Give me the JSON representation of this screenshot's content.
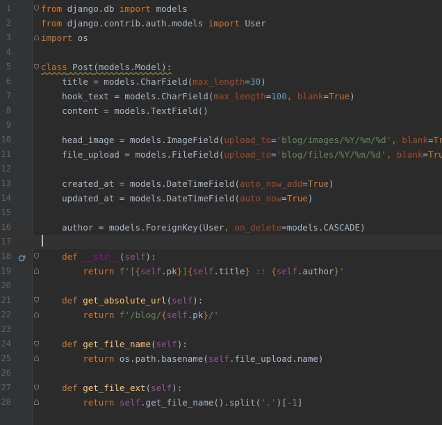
{
  "editor": {
    "current_line": 17,
    "lines": [
      {
        "n": "1",
        "fold": "open",
        "tokens": [
          {
            "t": "from",
            "c": "kw"
          },
          {
            "t": " django.db ",
            "c": ""
          },
          {
            "t": "import",
            "c": "kw"
          },
          {
            "t": " models",
            "c": ""
          }
        ]
      },
      {
        "n": "2",
        "fold": "none",
        "tokens": [
          {
            "t": "from",
            "c": "kw"
          },
          {
            "t": " django.contrib.auth.models ",
            "c": ""
          },
          {
            "t": "import",
            "c": "kw"
          },
          {
            "t": " User",
            "c": ""
          }
        ]
      },
      {
        "n": "3",
        "fold": "close",
        "tokens": [
          {
            "t": "import",
            "c": "kw"
          },
          {
            "t": " os",
            "c": ""
          }
        ]
      },
      {
        "n": "4",
        "fold": "none",
        "tokens": []
      },
      {
        "n": "5",
        "fold": "open",
        "tokens": [
          {
            "t": "class Post(models.Model):",
            "c": "kw wavy",
            "parts": [
              {
                "t": "class",
                "c": "kw"
              },
              {
                "t": " Post",
                "c": ""
              },
              {
                "t": "(models.Model):",
                "c": ""
              }
            ]
          }
        ]
      },
      {
        "n": "6",
        "fold": "none",
        "tokens": [
          {
            "t": "    title = models.",
            "c": ""
          },
          {
            "t": "CharField",
            "c": ""
          },
          {
            "t": "(",
            "c": ""
          },
          {
            "t": "max_length",
            "c": "param"
          },
          {
            "t": "=",
            "c": ""
          },
          {
            "t": "30",
            "c": "num"
          },
          {
            "t": ")",
            "c": ""
          }
        ]
      },
      {
        "n": "7",
        "fold": "none",
        "tokens": [
          {
            "t": "    hook_text = models.CharField(",
            "c": ""
          },
          {
            "t": "max_length",
            "c": "param"
          },
          {
            "t": "=",
            "c": ""
          },
          {
            "t": "100",
            "c": "num"
          },
          {
            "t": ", ",
            "c": "kw"
          },
          {
            "t": "blank",
            "c": "param"
          },
          {
            "t": "=",
            "c": ""
          },
          {
            "t": "True",
            "c": "kw"
          },
          {
            "t": ")",
            "c": ""
          }
        ]
      },
      {
        "n": "8",
        "fold": "none",
        "tokens": [
          {
            "t": "    content = models.TextField()",
            "c": ""
          }
        ]
      },
      {
        "n": "9",
        "fold": "none",
        "tokens": []
      },
      {
        "n": "10",
        "fold": "none",
        "tokens": [
          {
            "t": "    head_image = models.ImageField(",
            "c": ""
          },
          {
            "t": "upload_to",
            "c": "param"
          },
          {
            "t": "=",
            "c": ""
          },
          {
            "t": "'blog/images/%Y/%m/%d'",
            "c": "str"
          },
          {
            "t": ", ",
            "c": "kw"
          },
          {
            "t": "blank",
            "c": "param"
          },
          {
            "t": "=",
            "c": ""
          },
          {
            "t": "True",
            "c": "kw"
          },
          {
            "t": ")",
            "c": ""
          }
        ]
      },
      {
        "n": "11",
        "fold": "none",
        "tokens": [
          {
            "t": "    file_upload = models.FileField(",
            "c": ""
          },
          {
            "t": "upload_to",
            "c": "param"
          },
          {
            "t": "=",
            "c": ""
          },
          {
            "t": "'blog/files/%Y/%m/%d'",
            "c": "str"
          },
          {
            "t": ", ",
            "c": "kw"
          },
          {
            "t": "blank",
            "c": "param"
          },
          {
            "t": "=",
            "c": ""
          },
          {
            "t": "True",
            "c": "kw"
          },
          {
            "t": ")",
            "c": ""
          }
        ]
      },
      {
        "n": "12",
        "fold": "none",
        "tokens": []
      },
      {
        "n": "13",
        "fold": "none",
        "tokens": [
          {
            "t": "    created_at = models.DateTimeField(",
            "c": ""
          },
          {
            "t": "auto_now_add",
            "c": "param"
          },
          {
            "t": "=",
            "c": ""
          },
          {
            "t": "True",
            "c": "kw"
          },
          {
            "t": ")",
            "c": ""
          }
        ]
      },
      {
        "n": "14",
        "fold": "none",
        "tokens": [
          {
            "t": "    updated_at = models.DateTimeField(",
            "c": ""
          },
          {
            "t": "auto_now",
            "c": "param"
          },
          {
            "t": "=",
            "c": ""
          },
          {
            "t": "True",
            "c": "kw"
          },
          {
            "t": ")",
            "c": ""
          }
        ]
      },
      {
        "n": "15",
        "fold": "none",
        "tokens": []
      },
      {
        "n": "16",
        "fold": "none",
        "tokens": [
          {
            "t": "    author = models.ForeignKey(User",
            "c": ""
          },
          {
            "t": ", ",
            "c": "kw"
          },
          {
            "t": "on_delete",
            "c": "param"
          },
          {
            "t": "=models.CASCADE)",
            "c": ""
          }
        ]
      },
      {
        "n": "17",
        "fold": "none",
        "tokens": []
      },
      {
        "n": "18",
        "fold": "open",
        "icon": "override-method-icon",
        "tokens": [
          {
            "t": "    ",
            "c": ""
          },
          {
            "t": "def",
            "c": "kw"
          },
          {
            "t": " ",
            "c": ""
          },
          {
            "t": "__str__",
            "c": "magic"
          },
          {
            "t": "(",
            "c": ""
          },
          {
            "t": "self",
            "c": "self"
          },
          {
            "t": "):",
            "c": ""
          }
        ]
      },
      {
        "n": "19",
        "fold": "close",
        "tokens": [
          {
            "t": "        ",
            "c": ""
          },
          {
            "t": "return",
            "c": "kw"
          },
          {
            "t": " ",
            "c": ""
          },
          {
            "t": "f'[",
            "c": "str"
          },
          {
            "t": "{",
            "c": "brace"
          },
          {
            "t": "self",
            "c": "self"
          },
          {
            "t": ".pk",
            "c": ""
          },
          {
            "t": "}",
            "c": "brace"
          },
          {
            "t": "]",
            "c": "str"
          },
          {
            "t": "{",
            "c": "brace"
          },
          {
            "t": "self",
            "c": "self"
          },
          {
            "t": ".title",
            "c": ""
          },
          {
            "t": "}",
            "c": "brace"
          },
          {
            "t": " :: ",
            "c": "str"
          },
          {
            "t": "{",
            "c": "brace"
          },
          {
            "t": "self",
            "c": "self"
          },
          {
            "t": ".author",
            "c": ""
          },
          {
            "t": "}",
            "c": "brace"
          },
          {
            "t": "'",
            "c": "str"
          }
        ]
      },
      {
        "n": "20",
        "fold": "none",
        "tokens": []
      },
      {
        "n": "21",
        "fold": "open",
        "tokens": [
          {
            "t": "    ",
            "c": ""
          },
          {
            "t": "def",
            "c": "kw"
          },
          {
            "t": " ",
            "c": ""
          },
          {
            "t": "get_absolute_url",
            "c": "fn"
          },
          {
            "t": "(",
            "c": ""
          },
          {
            "t": "self",
            "c": "self"
          },
          {
            "t": "):",
            "c": ""
          }
        ]
      },
      {
        "n": "22",
        "fold": "close",
        "tokens": [
          {
            "t": "        ",
            "c": ""
          },
          {
            "t": "return",
            "c": "kw"
          },
          {
            "t": " ",
            "c": ""
          },
          {
            "t": "f'/blog/",
            "c": "str"
          },
          {
            "t": "{",
            "c": "brace"
          },
          {
            "t": "self",
            "c": "self"
          },
          {
            "t": ".pk",
            "c": ""
          },
          {
            "t": "}",
            "c": "brace"
          },
          {
            "t": "/'",
            "c": "str"
          }
        ]
      },
      {
        "n": "23",
        "fold": "none",
        "tokens": []
      },
      {
        "n": "24",
        "fold": "open",
        "tokens": [
          {
            "t": "    ",
            "c": ""
          },
          {
            "t": "def",
            "c": "kw"
          },
          {
            "t": " ",
            "c": ""
          },
          {
            "t": "get_file_name",
            "c": "fn"
          },
          {
            "t": "(",
            "c": ""
          },
          {
            "t": "self",
            "c": "self"
          },
          {
            "t": "):",
            "c": ""
          }
        ]
      },
      {
        "n": "25",
        "fold": "close",
        "tokens": [
          {
            "t": "        ",
            "c": ""
          },
          {
            "t": "return",
            "c": "kw"
          },
          {
            "t": " os.path.basename(",
            "c": ""
          },
          {
            "t": "self",
            "c": "self"
          },
          {
            "t": ".file_upload.name)",
            "c": ""
          }
        ]
      },
      {
        "n": "26",
        "fold": "none",
        "tokens": []
      },
      {
        "n": "27",
        "fold": "open",
        "tokens": [
          {
            "t": "    ",
            "c": ""
          },
          {
            "t": "def",
            "c": "kw"
          },
          {
            "t": " ",
            "c": ""
          },
          {
            "t": "get_file_ext",
            "c": "fn"
          },
          {
            "t": "(",
            "c": ""
          },
          {
            "t": "self",
            "c": "self"
          },
          {
            "t": "):",
            "c": ""
          }
        ]
      },
      {
        "n": "28",
        "fold": "close",
        "tokens": [
          {
            "t": "        ",
            "c": ""
          },
          {
            "t": "return",
            "c": "kw"
          },
          {
            "t": " ",
            "c": ""
          },
          {
            "t": "self",
            "c": "self"
          },
          {
            "t": ".get_file_name().split(",
            "c": ""
          },
          {
            "t": "'.'",
            "c": "str"
          },
          {
            "t": ")[",
            "c": ""
          },
          {
            "t": "-1",
            "c": "num"
          },
          {
            "t": "]",
            "c": ""
          }
        ]
      }
    ]
  }
}
